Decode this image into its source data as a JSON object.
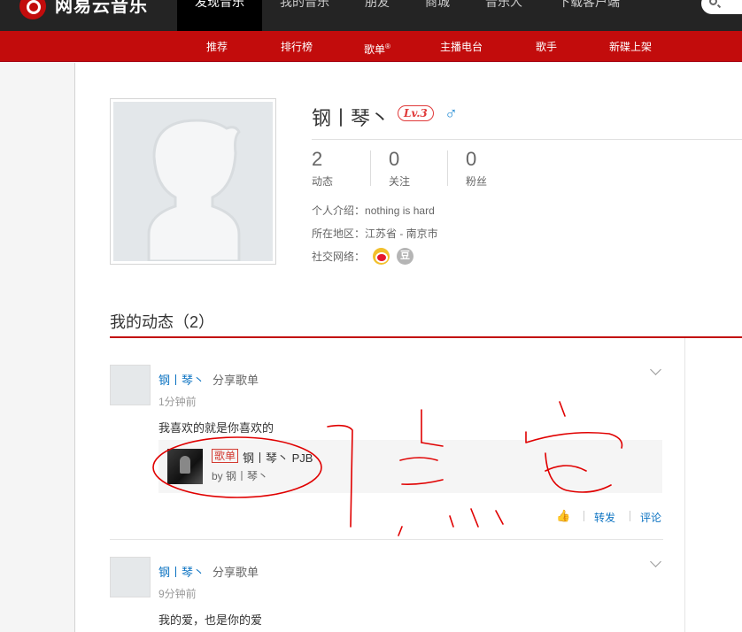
{
  "header": {
    "logo_text": "网易云音乐",
    "nav": [
      "发现音乐",
      "我的音乐",
      "朋友",
      "商城",
      "音乐人",
      "下载客户端"
    ]
  },
  "subnav": [
    "推荐",
    "排行榜",
    "歌单",
    "主播电台",
    "歌手",
    "新碟上架"
  ],
  "subnav_sup": "®",
  "profile": {
    "name": "钢丨琴丶",
    "level": "Lv.3",
    "gender_symbol": "♂",
    "stats": [
      {
        "num": "2",
        "label": "动态"
      },
      {
        "num": "0",
        "label": "关注"
      },
      {
        "num": "0",
        "label": "粉丝"
      }
    ],
    "bio_label": "个人介绍：",
    "bio": "nothing is hard",
    "location_label": "所在地区：",
    "location": "江苏省 - 南京市",
    "social_label": "社交网络：",
    "douban_glyph": "豆"
  },
  "feed": {
    "title": "我的动态（2）",
    "items": [
      {
        "name": "钢丨琴丶",
        "action": "分享歌单",
        "time": "1分钟前",
        "text": "我喜欢的就是你喜欢的",
        "card_tag": "歌单",
        "card_title": "钢丨琴丶 PJB",
        "card_by": "by 钢丨琴丶"
      },
      {
        "name": "钢丨琴丶",
        "action": "分享歌单",
        "time": "9分钟前",
        "text": "我的爱，也是你的爱"
      }
    ],
    "actions": {
      "like_glyph": "👍",
      "forward": "转发",
      "comment": "评论"
    }
  },
  "colors": {
    "brand": "#c20c0c",
    "link": "#0c73c2",
    "annotation": "#e00000"
  }
}
